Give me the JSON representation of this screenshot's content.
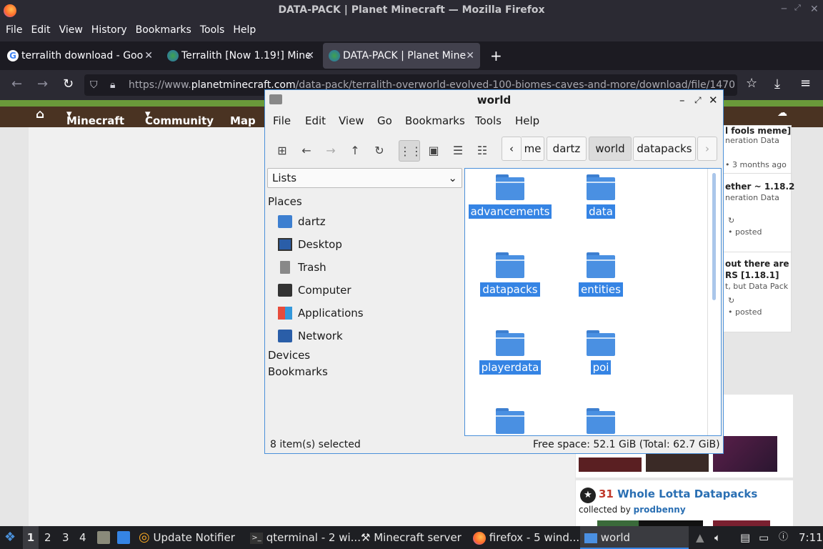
{
  "window": {
    "title": "DATA-PACK | Planet Minecraft — Mozilla Firefox"
  },
  "menu": [
    "File",
    "Edit",
    "View",
    "History",
    "Bookmarks",
    "Tools",
    "Help"
  ],
  "tabs": [
    {
      "label": "terralith download - Goo",
      "active": false
    },
    {
      "label": "Terralith [Now 1.19!] Mine",
      "active": false
    },
    {
      "label": "DATA-PACK | Planet Mine",
      "active": true
    }
  ],
  "url": {
    "prefix": "https://www.",
    "host": "planetminecraft.com",
    "path": "/data-pack/terralith-overworld-evolved-100-biomes-caves-and-more/download/file/1470"
  },
  "site_nav": {
    "minecraft": "Minecraft",
    "community": "Community",
    "maps": "Map"
  },
  "right_panel": {
    "item1_title": "l fools meme]",
    "item1_sub": "neration Data",
    "item1_time": "•  3 months ago",
    "item2_title": "ether ~ 1.18.2",
    "item2_sub": "neration Data",
    "item2_time": "• posted",
    "item3_title": "out there are",
    "item3_title2": "RS [1.18.1]",
    "item3_sub": "t, but Data Pack",
    "item3_time": "• posted"
  },
  "collection": {
    "count": "31",
    "title": "Whole Lotta Datapacks",
    "by_label": "collected by",
    "by_user": "prodbenny"
  },
  "file_manager": {
    "title": "world",
    "menu": [
      "File",
      "Edit",
      "View",
      "Go",
      "Bookmarks",
      "Tools",
      "Help"
    ],
    "breadcrumbs": [
      "me",
      "dartz",
      "world",
      "datapacks"
    ],
    "side_select": "Lists",
    "places_header": "Places",
    "places": [
      {
        "label": "dartz",
        "icon": "home-folder-icon"
      },
      {
        "label": "Desktop",
        "icon": "desktop-icon"
      },
      {
        "label": "Trash",
        "icon": "trash-icon"
      },
      {
        "label": "Computer",
        "icon": "computer-icon"
      },
      {
        "label": "Applications",
        "icon": "applications-icon"
      },
      {
        "label": "Network",
        "icon": "network-icon"
      }
    ],
    "devices_header": "Devices",
    "bookmarks_header": "Bookmarks",
    "items": [
      "advancements",
      "data",
      "datapacks",
      "entities",
      "playerdata",
      "poi"
    ],
    "status_selected": "8 item(s) selected",
    "status_space": "Free space: 52.1 GiB (Total: 62.7 GiB)"
  },
  "taskbar": {
    "workspaces": [
      "1",
      "2",
      "3",
      "4"
    ],
    "apps": [
      "Update Notifier",
      "qterminal - 2 wi...",
      "Minecraft server",
      "firefox - 5 wind...",
      "world"
    ],
    "clock": "7:11"
  }
}
